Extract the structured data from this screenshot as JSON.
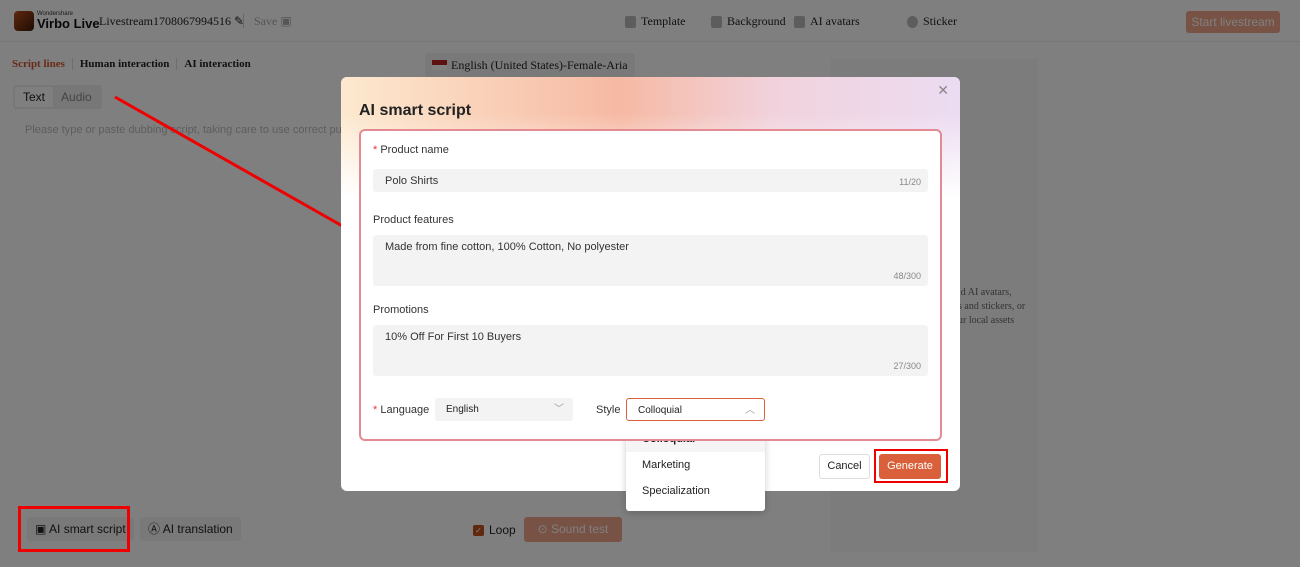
{
  "header": {
    "brand_small": "Wondershare",
    "brand": "Virbo Live",
    "project_title": "Livestream1708067994516",
    "save_label": "Save",
    "nav": [
      {
        "label": "Template",
        "icon": "template-icon"
      },
      {
        "label": "Background",
        "icon": "background-icon"
      },
      {
        "label": "AI avatars",
        "icon": "avatar-icon"
      },
      {
        "label": "Sticker",
        "icon": "sticker-icon"
      }
    ],
    "start_label": "Start livestream"
  },
  "left": {
    "tabs": [
      "Script lines",
      "Human interaction",
      "AI interaction"
    ],
    "voice": "English (United States)-Female-Aria",
    "modes": [
      "Text",
      "Audio"
    ],
    "placeholder": "Please type or paste dubbing script, taking care to use correct pun",
    "smart_script": "AI smart script",
    "translation": "AI translation",
    "loop": "Loop",
    "sound_test": "Sound test"
  },
  "preview": {
    "hint": [
      "ld AI avatars,",
      "s and stickers, or",
      "ur local assets"
    ]
  },
  "modal": {
    "title": "AI smart script",
    "product_name": {
      "label": "Product name",
      "value": "Polo Shirts",
      "count": "11/20"
    },
    "features": {
      "label": "Product features",
      "value": "Made from fine cotton, 100% Cotton, No polyester",
      "count": "48/300"
    },
    "promotions": {
      "label": "Promotions",
      "value": "10% Off For First 10 Buyers",
      "count": "27/300"
    },
    "language": {
      "label": "Language",
      "value": "English"
    },
    "style": {
      "label": "Style",
      "value": "Colloquial",
      "options": [
        "Colloquial",
        "Marketing",
        "Specialization"
      ]
    },
    "cancel": "Cancel",
    "generate": "Generate"
  },
  "colors": {
    "accent": "#d9603a",
    "annotation": "#e00000"
  }
}
